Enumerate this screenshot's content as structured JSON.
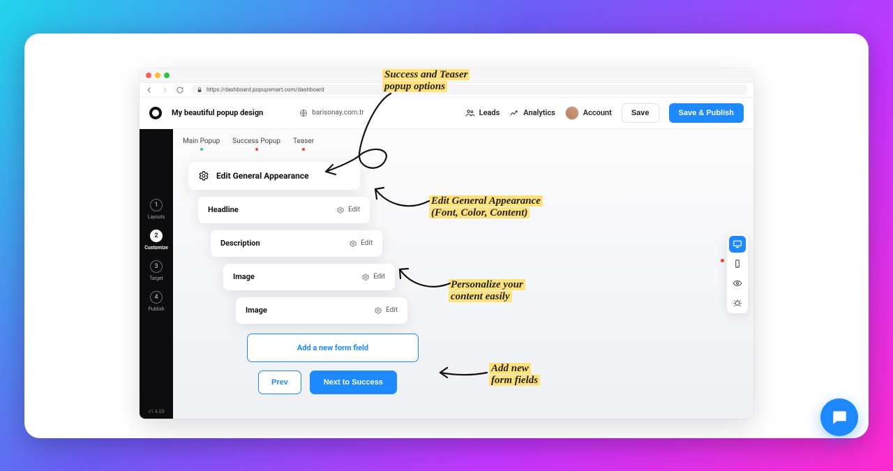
{
  "browser": {
    "url": "https://dashboard.popupsmart.com/dashboard"
  },
  "toolbar": {
    "project_title": "My beautiful popup design",
    "domain": "barisonay.com.tr",
    "leads": "Leads",
    "analytics": "Analytics",
    "account": "Account",
    "save": "Save",
    "save_publish": "Save & Publish"
  },
  "rail": {
    "steps": [
      {
        "num": "1",
        "label": "Layouts"
      },
      {
        "num": "2",
        "label": "Customize"
      },
      {
        "num": "3",
        "label": "Target"
      },
      {
        "num": "4",
        "label": "Publish"
      }
    ],
    "version": "v1.4.00"
  },
  "tabs": {
    "main": "Main Popup",
    "success": "Success Popup",
    "teaser": "Teaser"
  },
  "general_appearance": "Edit General Appearance",
  "rows": {
    "r1": "Headline",
    "r2": "Description",
    "r3": "Image",
    "r4": "Image",
    "edit": "Edit"
  },
  "add_field": "Add a new form field",
  "nav": {
    "prev": "Prev",
    "next": "Next to Success"
  },
  "annotations": {
    "a1_l1": "Success and Teaser",
    "a1_l2": "popup options",
    "a2_l1": "Edit General Appearance",
    "a2_l2": "(Font, Color, Content)",
    "a3_l1": "Personalize your",
    "a3_l2": "content easily",
    "a4_l1": "Add new",
    "a4_l2": "form fields"
  },
  "colors": {
    "green": "#2ecc71",
    "red": "#ff3b30",
    "blue": "#1e88ff"
  }
}
